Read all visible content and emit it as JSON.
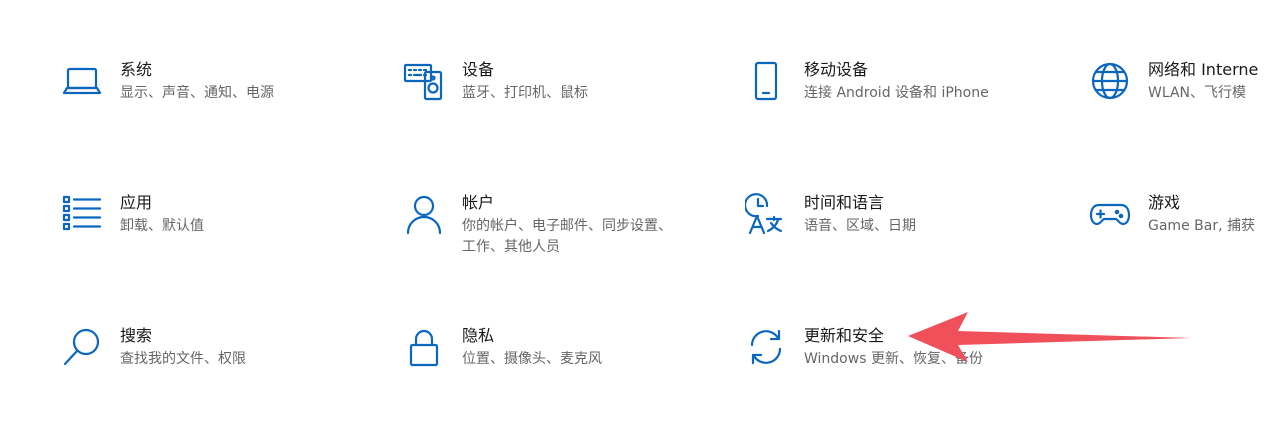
{
  "tiles": [
    {
      "title": "系统",
      "desc": "显示、声音、通知、电源",
      "icon": "laptop-icon"
    },
    {
      "title": "设备",
      "desc": "蓝牙、打印机、鼠标",
      "icon": "keyboard-speaker-icon"
    },
    {
      "title": "移动设备",
      "desc": "连接 Android 设备和 iPhone",
      "icon": "phone-icon"
    },
    {
      "title": "网络和 Interne",
      "desc": "WLAN、飞行模",
      "icon": "globe-icon"
    },
    {
      "title": "应用",
      "desc": "卸载、默认值",
      "icon": "apps-list-icon"
    },
    {
      "title": "帐户",
      "desc": "你的帐户、电子邮件、同步设置、工作、其他人员",
      "icon": "person-icon"
    },
    {
      "title": "时间和语言",
      "desc": "语音、区域、日期",
      "icon": "time-language-icon"
    },
    {
      "title": "游戏",
      "desc": "Game Bar, 捕获",
      "icon": "gamepad-icon"
    },
    {
      "title": "搜索",
      "desc": "查找我的文件、权限",
      "icon": "search-icon"
    },
    {
      "title": "隐私",
      "desc": "位置、摄像头、麦克风",
      "icon": "lock-icon"
    },
    {
      "title": "更新和安全",
      "desc": "Windows 更新、恢复、备份",
      "icon": "sync-icon"
    }
  ],
  "colors": {
    "accent": "#0b66c0",
    "annotation_arrow": "#f0505a"
  }
}
